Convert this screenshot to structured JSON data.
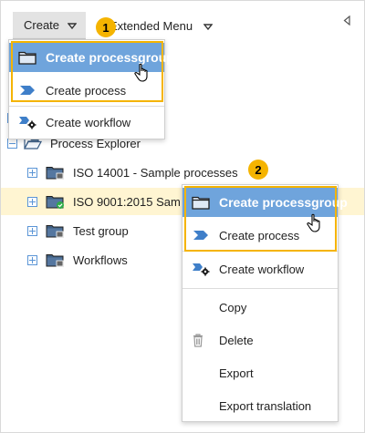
{
  "toolbar": {
    "create_label": "Create",
    "extended_menu_label": "Extended Menu"
  },
  "badges": {
    "step1": "1",
    "step2": "2"
  },
  "menu1": {
    "items": [
      {
        "label": "Create processgroup",
        "icon": "folder-icon",
        "highlighted": true
      },
      {
        "label": "Create process",
        "icon": "process-chevron-icon"
      },
      {
        "label": "Create workflow",
        "icon": "workflow-gear-icon"
      }
    ]
  },
  "menu2": {
    "items": [
      {
        "label": "Create processgroup",
        "icon": "folder-icon",
        "highlighted": true
      },
      {
        "label": "Create process",
        "icon": "process-chevron-icon"
      },
      {
        "label": "Create workflow",
        "icon": "workflow-gear-icon"
      },
      {
        "label": "Copy",
        "icon": ""
      },
      {
        "label": "Delete",
        "icon": "trash-icon"
      },
      {
        "label": "Export",
        "icon": ""
      },
      {
        "label": "Export translation",
        "icon": ""
      }
    ]
  },
  "tree": {
    "root": {
      "label": "Process Explorer"
    },
    "children": [
      {
        "label": "ISO 14001 - Sample processes",
        "status": "locked"
      },
      {
        "label": "ISO 9001:2015 Sam",
        "status": "approved",
        "selected": true
      },
      {
        "label": "Test group",
        "status": "locked"
      },
      {
        "label": "Workflows",
        "status": "locked"
      }
    ]
  },
  "colors": {
    "highlight": "#6fa4dc",
    "badge": "#f5b400",
    "selected_row": "#fff5d2",
    "toggle": "#5b95d6",
    "folder_fill": "#dfe9f5",
    "folder_stroke": "#3a5e86"
  }
}
